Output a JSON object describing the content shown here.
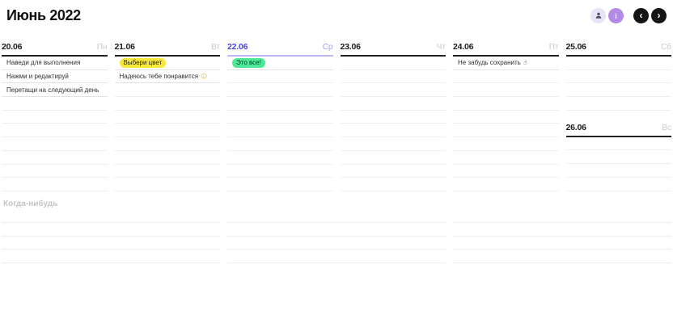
{
  "header": {
    "title": "Июнь 2022",
    "avatar_initial": "i",
    "prev": "‹",
    "next": "›"
  },
  "icons": {
    "profile": "user-icon",
    "prev": "chevron-left-icon",
    "next": "chevron-right-icon"
  },
  "week": {
    "days": [
      {
        "date": "20.06",
        "weekday": "Пн",
        "is_today": false,
        "tasks": [
          {
            "text": "Наведи для выполнения"
          },
          {
            "text": "Нажми и редактируй"
          },
          {
            "text": "Перетащи на следующий день"
          }
        ]
      },
      {
        "date": "21.06",
        "weekday": "Вт",
        "is_today": false,
        "tasks": [
          {
            "text": "Выбери цвет",
            "highlight": "yellow"
          },
          {
            "text": "Надеюсь тебе понравится",
            "emoji": "☺"
          }
        ]
      },
      {
        "date": "22.06",
        "weekday": "Ср",
        "is_today": true,
        "tasks": [
          {
            "text": "Это все!",
            "highlight": "green"
          }
        ]
      },
      {
        "date": "23.06",
        "weekday": "Чт",
        "is_today": false,
        "tasks": []
      },
      {
        "date": "24.06",
        "weekday": "Пт",
        "is_today": false,
        "tasks": [
          {
            "text": "Не забудь сохранить",
            "emoji": "☝"
          }
        ]
      },
      {
        "date": "25.06",
        "weekday": "Сб",
        "is_today": false,
        "tasks": []
      },
      {
        "date": "26.06",
        "weekday": "Вс",
        "is_today": false,
        "tasks": []
      }
    ]
  },
  "someday": {
    "label": "Когда-нибудь"
  },
  "colors": {
    "today_accent": "#4a45e8",
    "today_underline": "#b9b7f5",
    "highlight_yellow": "#f8e83a",
    "highlight_green": "#4de797",
    "avatar_bg": "#b48ae6",
    "profile_bg": "#e5e4f8",
    "nav_button_bg": "#141414"
  }
}
